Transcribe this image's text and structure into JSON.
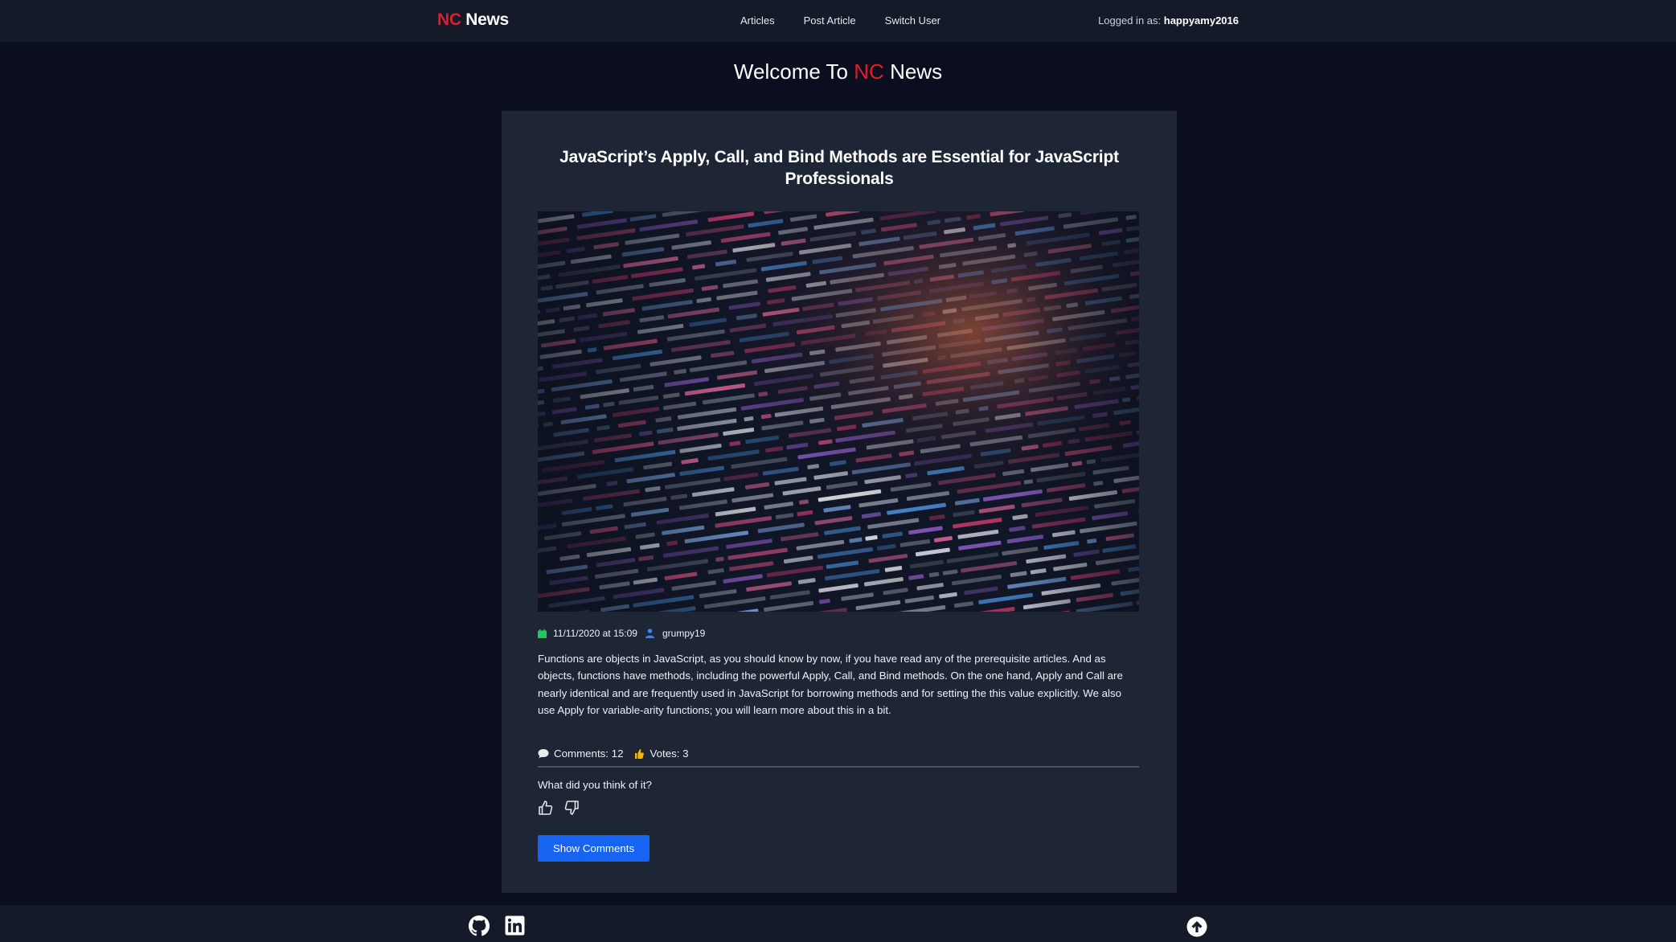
{
  "nav": {
    "brand_nc": "NC",
    "brand_news": "News",
    "links": [
      "Articles",
      "Post Article",
      "Switch User"
    ],
    "login_prefix": "Logged in as:",
    "login_user": "happyamy2016"
  },
  "welcome": {
    "prefix": "Welcome To",
    "nc": "NC",
    "suffix": "News"
  },
  "article": {
    "title": "JavaScript’s Apply, Call, and Bind Methods are Essential for JavaScript Professionals",
    "date": "11/11/2020 at 15:09",
    "author": "grumpy19",
    "body": "Functions are objects in JavaScript, as you should know by now, if you have read any of the prerequisite articles. And as objects, functions have methods, including the powerful Apply, Call, and Bind methods. On the one hand, Apply and Call are nearly identical and are frequently used in JavaScript for borrowing methods and for setting the this value explicitly. We also use Apply for variable-arity functions; you will learn more about this in a bit.",
    "comments_label": "Comments: 12",
    "votes_label": "Votes: 3",
    "feedback_prompt": "What did you think of it?",
    "show_comments_label": "Show Comments",
    "image_icon": "code-screen-photo"
  },
  "footer": {
    "icons": [
      "github-icon",
      "linkedin-icon",
      "back-to-top-icon"
    ]
  },
  "colors": {
    "background": "#0a0e1e",
    "navbar": "#151a28",
    "card": "#1e2636",
    "accent_red": "#e11d2e",
    "button_blue": "#1664f1",
    "calendar_green": "#22c55e",
    "user_blue": "#3b82f6",
    "thumb_yellow": "#f5b700"
  }
}
